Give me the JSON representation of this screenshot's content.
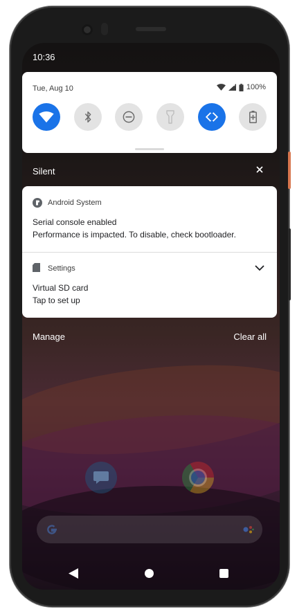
{
  "status_bar": {
    "time": "10:36"
  },
  "quick_settings": {
    "date": "Tue, Aug 10",
    "battery": "100%",
    "tiles": [
      {
        "icon": "wifi-icon",
        "state": "on"
      },
      {
        "icon": "bluetooth-icon",
        "state": "off"
      },
      {
        "icon": "do-not-disturb-icon",
        "state": "off"
      },
      {
        "icon": "flashlight-icon",
        "state": "off"
      },
      {
        "icon": "auto-rotate-icon",
        "state": "on"
      },
      {
        "icon": "battery-saver-icon",
        "state": "off"
      }
    ],
    "accent": "#1a73e8"
  },
  "notifications": {
    "section_label": "Silent",
    "items": [
      {
        "app": "Android System",
        "title": "Serial console enabled",
        "text": "Performance is impacted. To disable, check bootloader."
      },
      {
        "app": "Settings",
        "title": "Virtual SD card",
        "text": "Tap to set up"
      }
    ],
    "manage_label": "Manage",
    "clear_label": "Clear all"
  },
  "navigation": {
    "back_icon": "back-icon",
    "home_icon": "home-icon",
    "recents_icon": "recents-icon"
  }
}
